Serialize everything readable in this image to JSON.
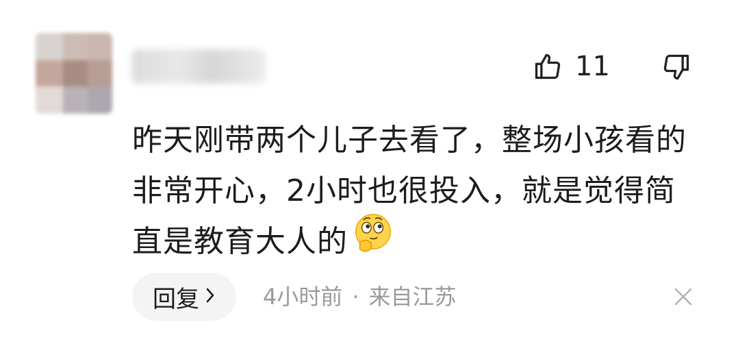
{
  "comment": {
    "like_count": "11",
    "text": "昨天刚带两个儿子去看了，整场小孩看的非常开心，2小时也很投入，就是觉得简直是教育大人的",
    "emoji_icon": "thinking-face-emoji",
    "reply_label": "回复",
    "time": "4小时前",
    "separator": "·",
    "location": "来自江苏"
  },
  "icons": {
    "like": "thumbs-up-icon",
    "dislike": "thumbs-down-icon",
    "close": "close-icon",
    "chevron": "chevron-right-icon"
  },
  "colors": {
    "text": "#1c1c1c",
    "meta": "#9a9a9a",
    "reply_bg": "#f4f4f4",
    "icon": "#222222",
    "close": "#b0b0b0"
  }
}
